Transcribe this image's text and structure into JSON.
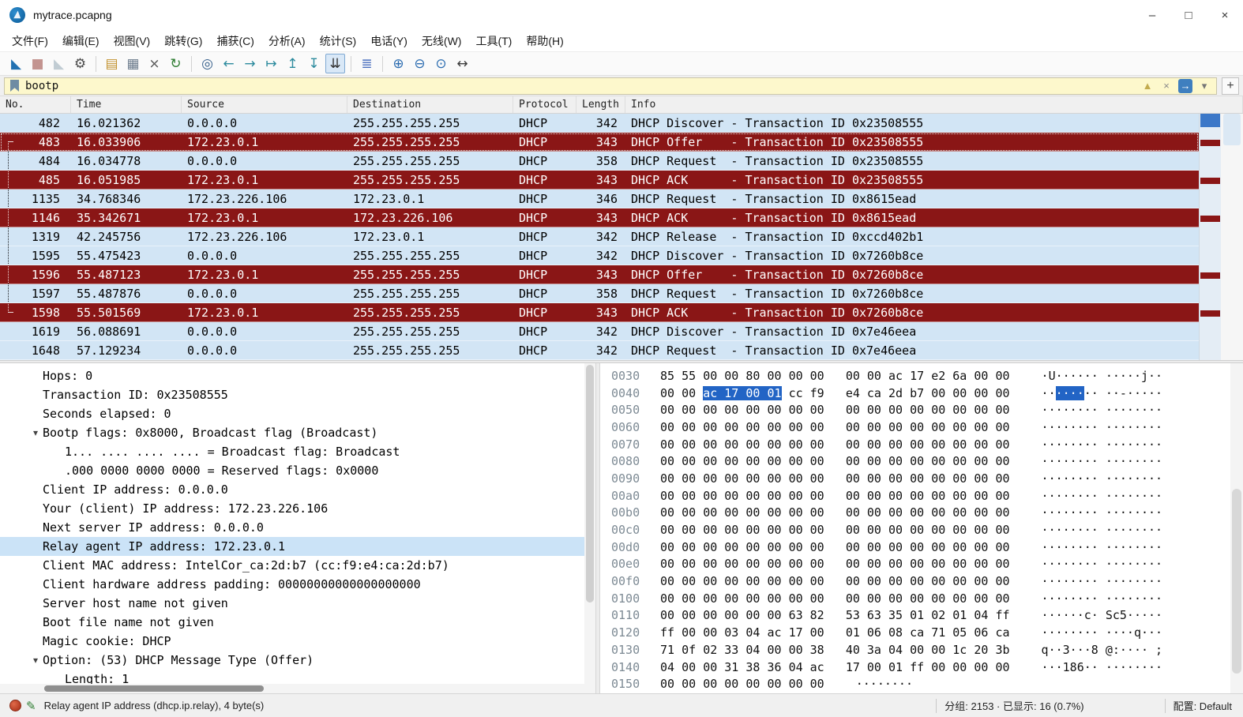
{
  "window": {
    "title": "mytrace.pcapng",
    "controls": {
      "minimize": "–",
      "maximize": "□",
      "close": "×"
    }
  },
  "menu": [
    "文件(F)",
    "编辑(E)",
    "视图(V)",
    "跳转(G)",
    "捕获(C)",
    "分析(A)",
    "统计(S)",
    "电话(Y)",
    "无线(W)",
    "工具(T)",
    "帮助(H)"
  ],
  "toolbar": [
    {
      "name": "start-capture-button",
      "glyph": "◣",
      "color": "#2271b1"
    },
    {
      "name": "stop-capture-button",
      "glyph": "■",
      "color": "#97423a",
      "disabled": true
    },
    {
      "name": "restart-capture-button",
      "glyph": "◣",
      "color": "#93a8b4",
      "disabled": true
    },
    {
      "name": "capture-options-button",
      "glyph": "⚙",
      "color": "#4a4a4a"
    },
    {
      "sep": true
    },
    {
      "name": "open-file-button",
      "glyph": "▤",
      "color": "#c2912e"
    },
    {
      "name": "save-file-button",
      "glyph": "▦",
      "color": "#6b7b8c"
    },
    {
      "name": "close-file-button",
      "glyph": "×",
      "color": "#555555"
    },
    {
      "name": "reload-file-button",
      "glyph": "↻",
      "color": "#2f7d32"
    },
    {
      "sep": true
    },
    {
      "name": "find-packet-button",
      "glyph": "◎",
      "color": "#38618c"
    },
    {
      "name": "go-back-button",
      "glyph": "←",
      "color": "#2b8a9d"
    },
    {
      "name": "go-forward-button",
      "glyph": "→",
      "color": "#2b8a9d"
    },
    {
      "name": "go-to-packet-button",
      "glyph": "↦",
      "color": "#2b8a9d"
    },
    {
      "name": "go-first-packet-button",
      "glyph": "↥",
      "color": "#2b8a9d"
    },
    {
      "name": "go-last-packet-button",
      "glyph": "↧",
      "color": "#2b8a9d"
    },
    {
      "name": "auto-scroll-toggle",
      "glyph": "⇊",
      "color": "#333333",
      "toggled": true
    },
    {
      "sep": true
    },
    {
      "name": "colorize-toggle",
      "glyph": "≣",
      "color": "#4a6fbe"
    },
    {
      "sep": true
    },
    {
      "name": "zoom-in-button",
      "glyph": "⊕",
      "color": "#2b6cb0"
    },
    {
      "name": "zoom-out-button",
      "glyph": "⊖",
      "color": "#2b6cb0"
    },
    {
      "name": "zoom-100-button",
      "glyph": "⊙",
      "color": "#2b6cb0"
    },
    {
      "name": "resize-columns-button",
      "glyph": "↔",
      "color": "#3a3a3a"
    }
  ],
  "filter": {
    "value": "bootp",
    "icons": [
      {
        "name": "filter-warning-icon",
        "glyph": "▲",
        "color": "#c2ab4e"
      },
      {
        "name": "filter-clear-icon",
        "glyph": "×",
        "color": "#8a8a8a"
      },
      {
        "name": "filter-apply-icon",
        "glyph": "→",
        "color": "#ffffff",
        "boxed": true
      },
      {
        "name": "filter-history-chevron-icon",
        "glyph": "▾",
        "color": "#777777"
      }
    ],
    "add_button": "+"
  },
  "packet_list": {
    "columns": [
      "No.",
      "Time",
      "Source",
      "Destination",
      "Protocol",
      "Length",
      "Info"
    ],
    "rows": [
      {
        "no": "482",
        "time": "16.021362",
        "source": "0.0.0.0",
        "destination": "255.255.255.255",
        "protocol": "DHCP",
        "length": "342",
        "info": "DHCP Discover - Transaction ID 0x23508555",
        "color": "blue",
        "mark": ""
      },
      {
        "no": "483",
        "time": "16.033906",
        "source": "172.23.0.1",
        "destination": "255.255.255.255",
        "protocol": "DHCP",
        "length": "343",
        "info": "DHCP Offer    - Transaction ID 0x23508555",
        "color": "red",
        "mark": "corner-top",
        "selected": true
      },
      {
        "no": "484",
        "time": "16.034778",
        "source": "0.0.0.0",
        "destination": "255.255.255.255",
        "protocol": "DHCP",
        "length": "358",
        "info": "DHCP Request  - Transaction ID 0x23508555",
        "color": "blue",
        "mark": "dotted"
      },
      {
        "no": "485",
        "time": "16.051985",
        "source": "172.23.0.1",
        "destination": "255.255.255.255",
        "protocol": "DHCP",
        "length": "343",
        "info": "DHCP ACK      - Transaction ID 0x23508555",
        "color": "red",
        "mark": "dotted"
      },
      {
        "no": "1135",
        "time": "34.768346",
        "source": "172.23.226.106",
        "destination": "172.23.0.1",
        "protocol": "DHCP",
        "length": "346",
        "info": "DHCP Request  - Transaction ID 0x8615ead",
        "color": "blue",
        "mark": "dotted"
      },
      {
        "no": "1146",
        "time": "35.342671",
        "source": "172.23.0.1",
        "destination": "172.23.226.106",
        "protocol": "DHCP",
        "length": "343",
        "info": "DHCP ACK      - Transaction ID 0x8615ead",
        "color": "red",
        "mark": "dotted"
      },
      {
        "no": "1319",
        "time": "42.245756",
        "source": "172.23.226.106",
        "destination": "172.23.0.1",
        "protocol": "DHCP",
        "length": "342",
        "info": "DHCP Release  - Transaction ID 0xccd402b1",
        "color": "blue",
        "mark": "dotted"
      },
      {
        "no": "1595",
        "time": "55.475423",
        "source": "0.0.0.0",
        "destination": "255.255.255.255",
        "protocol": "DHCP",
        "length": "342",
        "info": "DHCP Discover - Transaction ID 0x7260b8ce",
        "color": "blue",
        "mark": "dotted"
      },
      {
        "no": "1596",
        "time": "55.487123",
        "source": "172.23.0.1",
        "destination": "255.255.255.255",
        "protocol": "DHCP",
        "length": "343",
        "info": "DHCP Offer    - Transaction ID 0x7260b8ce",
        "color": "red",
        "mark": "dotted"
      },
      {
        "no": "1597",
        "time": "55.487876",
        "source": "0.0.0.0",
        "destination": "255.255.255.255",
        "protocol": "DHCP",
        "length": "358",
        "info": "DHCP Request  - Transaction ID 0x7260b8ce",
        "color": "blue",
        "mark": "dotted"
      },
      {
        "no": "1598",
        "time": "55.501569",
        "source": "172.23.0.1",
        "destination": "255.255.255.255",
        "protocol": "DHCP",
        "length": "343",
        "info": "DHCP ACK      - Transaction ID 0x7260b8ce",
        "color": "red",
        "mark": "corner-bottom"
      },
      {
        "no": "1619",
        "time": "56.088691",
        "source": "0.0.0.0",
        "destination": "255.255.255.255",
        "protocol": "DHCP",
        "length": "342",
        "info": "DHCP Discover - Transaction ID 0x7e46eea",
        "color": "blue",
        "mark": ""
      },
      {
        "no": "1648",
        "time": "57.129234",
        "source": "0.0.0.0",
        "destination": "255.255.255.255",
        "protocol": "DHCP",
        "length": "342",
        "info": "DHCP Request  - Transaction ID 0x7e46eea",
        "color": "blue",
        "mark": ""
      }
    ]
  },
  "details": {
    "lines": [
      {
        "indent": 1,
        "exp": "",
        "text": "Hops: 0"
      },
      {
        "indent": 1,
        "exp": "",
        "text": "Transaction ID: 0x23508555"
      },
      {
        "indent": 1,
        "exp": "",
        "text": "Seconds elapsed: 0"
      },
      {
        "indent": 1,
        "exp": "v",
        "text": "Bootp flags: 0x8000, Broadcast flag (Broadcast)"
      },
      {
        "indent": 2,
        "exp": "",
        "text": "1... .... .... .... = Broadcast flag: Broadcast"
      },
      {
        "indent": 2,
        "exp": "",
        "text": ".000 0000 0000 0000 = Reserved flags: 0x0000"
      },
      {
        "indent": 1,
        "exp": "",
        "text": "Client IP address: 0.0.0.0"
      },
      {
        "indent": 1,
        "exp": "",
        "text": "Your (client) IP address: 172.23.226.106"
      },
      {
        "indent": 1,
        "exp": "",
        "text": "Next server IP address: 0.0.0.0"
      },
      {
        "indent": 1,
        "exp": "",
        "text": "Relay agent IP address: 172.23.0.1",
        "selected": true
      },
      {
        "indent": 1,
        "exp": "",
        "text": "Client MAC address: IntelCor_ca:2d:b7 (cc:f9:e4:ca:2d:b7)"
      },
      {
        "indent": 1,
        "exp": "",
        "text": "Client hardware address padding: 00000000000000000000"
      },
      {
        "indent": 1,
        "exp": "",
        "text": "Server host name not given"
      },
      {
        "indent": 1,
        "exp": "",
        "text": "Boot file name not given"
      },
      {
        "indent": 1,
        "exp": "",
        "text": "Magic cookie: DHCP"
      },
      {
        "indent": 1,
        "exp": "v",
        "text": "Option: (53) DHCP Message Type (Offer)"
      },
      {
        "indent": 2,
        "exp": "",
        "text": "Length: 1"
      }
    ]
  },
  "hexdump": {
    "rows": [
      {
        "offset": "0030",
        "bytes": [
          "85",
          "55",
          "00",
          "00",
          "80",
          "00",
          "00",
          "00",
          "00",
          "00",
          "ac",
          "17",
          "e2",
          "6a",
          "00",
          "00"
        ],
        "ascii": "·U···········j··"
      },
      {
        "offset": "0040",
        "bytes": [
          "00",
          "00",
          "ac",
          "17",
          "00",
          "01",
          "cc",
          "f9",
          "e4",
          "ca",
          "2d",
          "b7",
          "00",
          "00",
          "00",
          "00"
        ],
        "ascii": "··········-·····",
        "sel": [
          2,
          5
        ]
      },
      {
        "offset": "0050",
        "bytes": [
          "00",
          "00",
          "00",
          "00",
          "00",
          "00",
          "00",
          "00",
          "00",
          "00",
          "00",
          "00",
          "00",
          "00",
          "00",
          "00"
        ],
        "ascii": "················"
      },
      {
        "offset": "0060",
        "bytes": [
          "00",
          "00",
          "00",
          "00",
          "00",
          "00",
          "00",
          "00",
          "00",
          "00",
          "00",
          "00",
          "00",
          "00",
          "00",
          "00"
        ],
        "ascii": "················"
      },
      {
        "offset": "0070",
        "bytes": [
          "00",
          "00",
          "00",
          "00",
          "00",
          "00",
          "00",
          "00",
          "00",
          "00",
          "00",
          "00",
          "00",
          "00",
          "00",
          "00"
        ],
        "ascii": "················"
      },
      {
        "offset": "0080",
        "bytes": [
          "00",
          "00",
          "00",
          "00",
          "00",
          "00",
          "00",
          "00",
          "00",
          "00",
          "00",
          "00",
          "00",
          "00",
          "00",
          "00"
        ],
        "ascii": "················"
      },
      {
        "offset": "0090",
        "bytes": [
          "00",
          "00",
          "00",
          "00",
          "00",
          "00",
          "00",
          "00",
          "00",
          "00",
          "00",
          "00",
          "00",
          "00",
          "00",
          "00"
        ],
        "ascii": "················"
      },
      {
        "offset": "00a0",
        "bytes": [
          "00",
          "00",
          "00",
          "00",
          "00",
          "00",
          "00",
          "00",
          "00",
          "00",
          "00",
          "00",
          "00",
          "00",
          "00",
          "00"
        ],
        "ascii": "················"
      },
      {
        "offset": "00b0",
        "bytes": [
          "00",
          "00",
          "00",
          "00",
          "00",
          "00",
          "00",
          "00",
          "00",
          "00",
          "00",
          "00",
          "00",
          "00",
          "00",
          "00"
        ],
        "ascii": "················"
      },
      {
        "offset": "00c0",
        "bytes": [
          "00",
          "00",
          "00",
          "00",
          "00",
          "00",
          "00",
          "00",
          "00",
          "00",
          "00",
          "00",
          "00",
          "00",
          "00",
          "00"
        ],
        "ascii": "················"
      },
      {
        "offset": "00d0",
        "bytes": [
          "00",
          "00",
          "00",
          "00",
          "00",
          "00",
          "00",
          "00",
          "00",
          "00",
          "00",
          "00",
          "00",
          "00",
          "00",
          "00"
        ],
        "ascii": "················"
      },
      {
        "offset": "00e0",
        "bytes": [
          "00",
          "00",
          "00",
          "00",
          "00",
          "00",
          "00",
          "00",
          "00",
          "00",
          "00",
          "00",
          "00",
          "00",
          "00",
          "00"
        ],
        "ascii": "················"
      },
      {
        "offset": "00f0",
        "bytes": [
          "00",
          "00",
          "00",
          "00",
          "00",
          "00",
          "00",
          "00",
          "00",
          "00",
          "00",
          "00",
          "00",
          "00",
          "00",
          "00"
        ],
        "ascii": "················"
      },
      {
        "offset": "0100",
        "bytes": [
          "00",
          "00",
          "00",
          "00",
          "00",
          "00",
          "00",
          "00",
          "00",
          "00",
          "00",
          "00",
          "00",
          "00",
          "00",
          "00"
        ],
        "ascii": "················"
      },
      {
        "offset": "0110",
        "bytes": [
          "00",
          "00",
          "00",
          "00",
          "00",
          "00",
          "63",
          "82",
          "53",
          "63",
          "35",
          "01",
          "02",
          "01",
          "04",
          "ff"
        ],
        "ascii": "······c·Sc5·····"
      },
      {
        "offset": "0120",
        "bytes": [
          "ff",
          "00",
          "00",
          "03",
          "04",
          "ac",
          "17",
          "00",
          "01",
          "06",
          "08",
          "ca",
          "71",
          "05",
          "06",
          "ca"
        ],
        "ascii": "············q···"
      },
      {
        "offset": "0130",
        "bytes": [
          "71",
          "0f",
          "02",
          "33",
          "04",
          "00",
          "00",
          "38",
          "40",
          "3a",
          "04",
          "00",
          "00",
          "1c",
          "20",
          "3b"
        ],
        "ascii": "q··3···8@:···· ;"
      },
      {
        "offset": "0140",
        "bytes": [
          "04",
          "00",
          "00",
          "31",
          "38",
          "36",
          "04",
          "ac",
          "17",
          "00",
          "01",
          "ff",
          "00",
          "00",
          "00",
          "00"
        ],
        "ascii": "···186··········"
      },
      {
        "offset": "0150",
        "bytes": [
          "00",
          "00",
          "00",
          "00",
          "00",
          "00",
          "00",
          "00"
        ],
        "ascii": "········"
      }
    ]
  },
  "statusbar": {
    "comment_glyph": "✎",
    "field_info": "Relay agent IP address (dhcp.ip.relay), 4 byte(s)",
    "packets_info": "分组: 2153 · 已显示: 16 (0.7%)",
    "profile": "配置: Default"
  },
  "colors": {
    "row_blue": "#d2e5f5",
    "row_red": "#8a1616",
    "selection_blue": "#2264c5",
    "filter_bg": "#fdf8cc",
    "detail_selected": "#cbe3f7",
    "minimap_bg": "#e4edf5",
    "accent": "#2271b1"
  }
}
